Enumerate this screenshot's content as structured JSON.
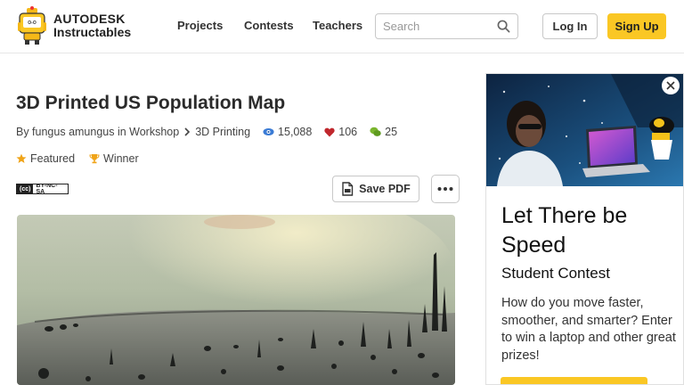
{
  "header": {
    "brand_line1": "AUTODESK",
    "brand_line2": "Instructables",
    "nav": [
      "Projects",
      "Contests",
      "Teachers"
    ],
    "search_placeholder": "Search",
    "login_label": "Log In",
    "signup_label": "Sign Up",
    "accent_color": "#fac724"
  },
  "article": {
    "title": "3D Printed US Population Map",
    "byline": "By fungus amungus in Workshop",
    "category": "3D Printing",
    "views": "15,088",
    "favorites": "106",
    "comments": "25",
    "badges": [
      "Featured",
      "Winner"
    ],
    "license_cc": "(cc)",
    "license_text": "BY-NC-SA",
    "save_pdf_label": "Save PDF",
    "more_icon": "more-dots-icon"
  },
  "ad": {
    "headline": "Let There be Speed",
    "subhead": "Student Contest",
    "body": "How do you move faster, smoother, and smarter? Enter to win a laptop and other great prizes!"
  }
}
